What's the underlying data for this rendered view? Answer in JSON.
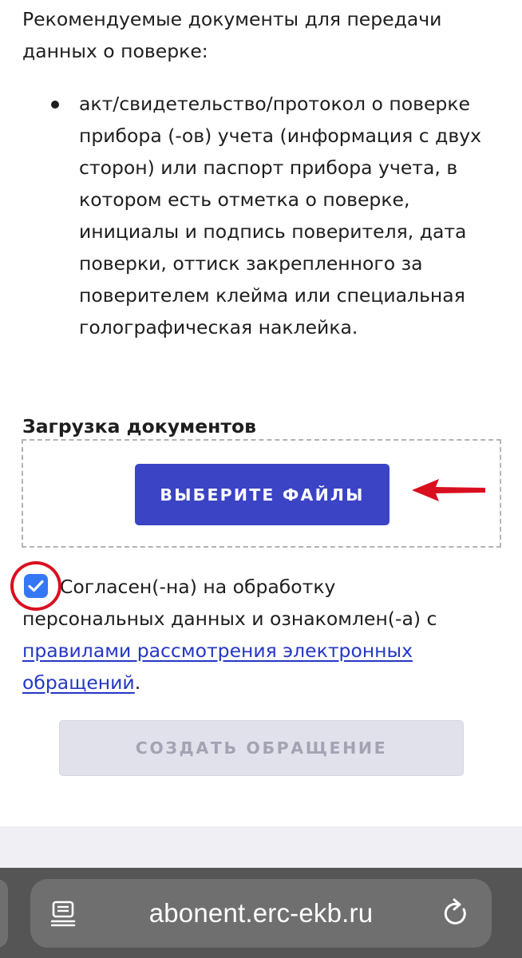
{
  "intro": {
    "heading": "Рекомендуемые документы для передачи данных о поверке:"
  },
  "documents": [
    "акт/свидетельство/протокол о поверке прибора (-ов) учета (информация с двух сторон) или паспорт прибора учета, в котором есть отметка о поверке, инициалы и подпись поверителя, дата поверки, оттиск закрепленного за поверителем клейма или специальная голографическая наклейка."
  ],
  "upload": {
    "title": "Загрузка документов",
    "choose_button": "ВЫБЕРИТЕ ФАЙЛЫ"
  },
  "consent": {
    "checked": true,
    "text_line1": "Согласен(-на) на обработку",
    "text_line2": "персональных данных и ознакомлен(-а) с",
    "link_text": "правилами рассмотрения электронных обращений",
    "trailing": "."
  },
  "submit": {
    "label": "СОЗДАТЬ ОБРАЩЕНИЕ",
    "disabled": true
  },
  "browser": {
    "url": "abonent.erc-ekb.ru"
  },
  "colors": {
    "primary": "#3a44c4",
    "checkbox": "#3478f6",
    "annotation": "#d90f20",
    "link": "#2437c6"
  },
  "icons": {
    "reader": "reader-mode-icon",
    "reload": "reload-icon",
    "annotation_arrow": "arrow-left-icon",
    "annotation_circle": "highlight-circle"
  }
}
